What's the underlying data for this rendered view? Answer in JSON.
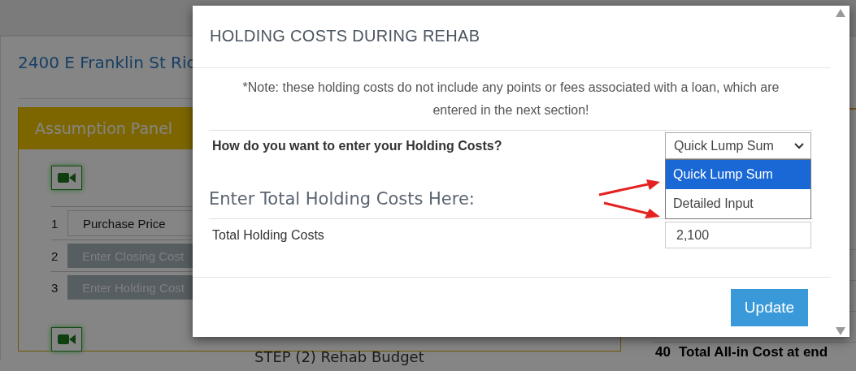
{
  "page": {
    "address": "2400 E Franklin St Ric",
    "panel_title": "Assumption Panel",
    "steps": [
      {
        "number": "1",
        "label": "Purchase Price",
        "kind": "field"
      },
      {
        "number": "2",
        "label": "Enter Closing Cost",
        "kind": "button"
      },
      {
        "number": "3",
        "label": "Enter Holding Cost",
        "kind": "button"
      }
    ],
    "step_heading": "STEP (2) Rehab Budget",
    "total_row": {
      "number": "40",
      "label": "Total All-in Cost at end"
    }
  },
  "modal": {
    "title": "HOLDING COSTS DURING REHAB",
    "note": "*Note: these holding costs do not include any points or fees associated with a loan, which are entered in the next section!",
    "question": "How do you want to enter your Holding Costs?",
    "select": {
      "value": "Quick Lump Sum",
      "expanded": true,
      "options": [
        {
          "label": "Quick Lump Sum",
          "selected": true
        },
        {
          "label": "Detailed Input",
          "selected": false
        }
      ]
    },
    "section_heading": "Enter Total Holding Costs Here:",
    "total_label": "Total Holding Costs",
    "total_value": "2,100",
    "button": "Update"
  }
}
